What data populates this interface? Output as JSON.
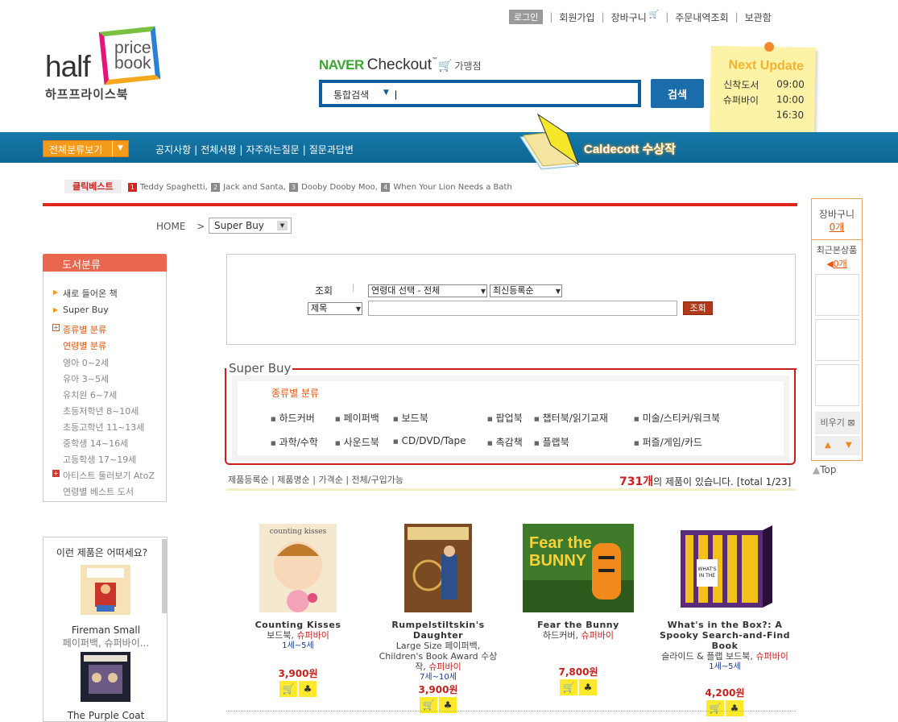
{
  "top_nav": {
    "login": "로그인",
    "items": [
      "회원가입",
      "장바구니",
      "주문내역조회",
      "보관함"
    ]
  },
  "logo": {
    "half": "half",
    "price": "price",
    "book": "book",
    "korean": "하프프라이스북"
  },
  "naver": {
    "brand": "NAVER",
    "checkout": "Checkout",
    "tm": "™",
    "member": "가맹점"
  },
  "search": {
    "scope": "통합검색",
    "value": "|",
    "button": "검색"
  },
  "update_note": {
    "title": "Next Update",
    "rows": [
      {
        "label": "신착도서",
        "time": "09:00"
      },
      {
        "label": "슈퍼바이",
        "time": "10:00"
      },
      {
        "label": "",
        "time": "16:30"
      }
    ]
  },
  "nav_bar": {
    "category_button": "전체분류보기",
    "links": [
      "공지사항",
      "전체서평",
      "자주하는질문",
      "질문과답변"
    ],
    "banner": "Caldecott 수상작"
  },
  "best": {
    "label": "클릭베스트",
    "items": [
      {
        "num": "1",
        "title": "Teddy Spaghetti,"
      },
      {
        "num": "2",
        "title": "Jack and Santa,"
      },
      {
        "num": "3",
        "title": "Dooby Dooby Moo,"
      },
      {
        "num": "4",
        "title": "When Your Lion Needs a Bath"
      }
    ]
  },
  "breadcrumb": {
    "home": "HOME",
    "sep": ">",
    "current": "Super Buy"
  },
  "sidebar": {
    "title": "도서분류",
    "items": [
      "새로 들어온 책",
      "Super Buy",
      "종류별 분류",
      "연령별 분류",
      "영아 0~2세",
      "유아 3~5세",
      "유치원 6~7세",
      "초등저학년 8~10세",
      "초등고학년 11~13세",
      "중학생 14~16세",
      "고등학생 17~19세",
      "아티스트 둘러보기 AtoZ",
      "연령별 베스트 도서"
    ]
  },
  "recommend": {
    "title": "이런 제품은 어떠세요?",
    "items": [
      {
        "name": "Fireman Small",
        "format": "페이퍼백, 슈퍼바이..."
      },
      {
        "name": "The Purple Coat",
        "format": ""
      }
    ]
  },
  "query": {
    "label": "조회",
    "age_select": "연령대 선택 - 전체",
    "order_select": "최신등록순",
    "field_select": "제목",
    "input": "",
    "button": "조회"
  },
  "superbuy": {
    "title": "Super Buy",
    "category_label": "종류별 분류",
    "row1": [
      "하드커버",
      "페이퍼백",
      "보드북",
      "팝업북",
      "챕터북/읽기교재",
      "미술/스티커/워크북"
    ],
    "row2": [
      "과학/수학",
      "사운드북",
      "CD/DVD/Tape",
      "촉감책",
      "플랩북",
      "퍼즐/게임/카드"
    ]
  },
  "sort": {
    "options": "제품등록순 | 제품명순 | 가격순 | 전체/구입가능",
    "count": "731개",
    "count_suffix": "의 제품이 있습니다.",
    "total": "[total 1/23]"
  },
  "products": [
    {
      "name": "Counting Kisses",
      "format": "보드북, ",
      "special": "슈퍼바이",
      "age": "1세~5세",
      "price": "3,900원"
    },
    {
      "name": "Rumpelstiltskin's Daughter",
      "format": "Large Size 페이퍼백, Children's Book Award 수상작, ",
      "special": "슈퍼바이",
      "age": "7세~10세",
      "price": "3,900원"
    },
    {
      "name": "Fear the Bunny",
      "format": "하드커버, ",
      "special": "슈퍼바이",
      "age": "",
      "price": "7,800원"
    },
    {
      "name": "What's in the Box?: A Spooky Search-and-Find Book",
      "format": "슬라이드 & 플랩 보드북, ",
      "special": "슈퍼바이",
      "age": "1세~5세",
      "price": "4,200원"
    }
  ],
  "right_panel": {
    "cart_label": "장바구니",
    "cart_count": "0개",
    "recent_label": "최근본상품",
    "recent_count": "0개",
    "clear": "비우기",
    "top": "Top"
  },
  "colors": {
    "accent_red": "#e0261d",
    "nav_blue": "#1779a8",
    "orange": "#f39a1a",
    "note_yellow": "#fdf3a6"
  }
}
